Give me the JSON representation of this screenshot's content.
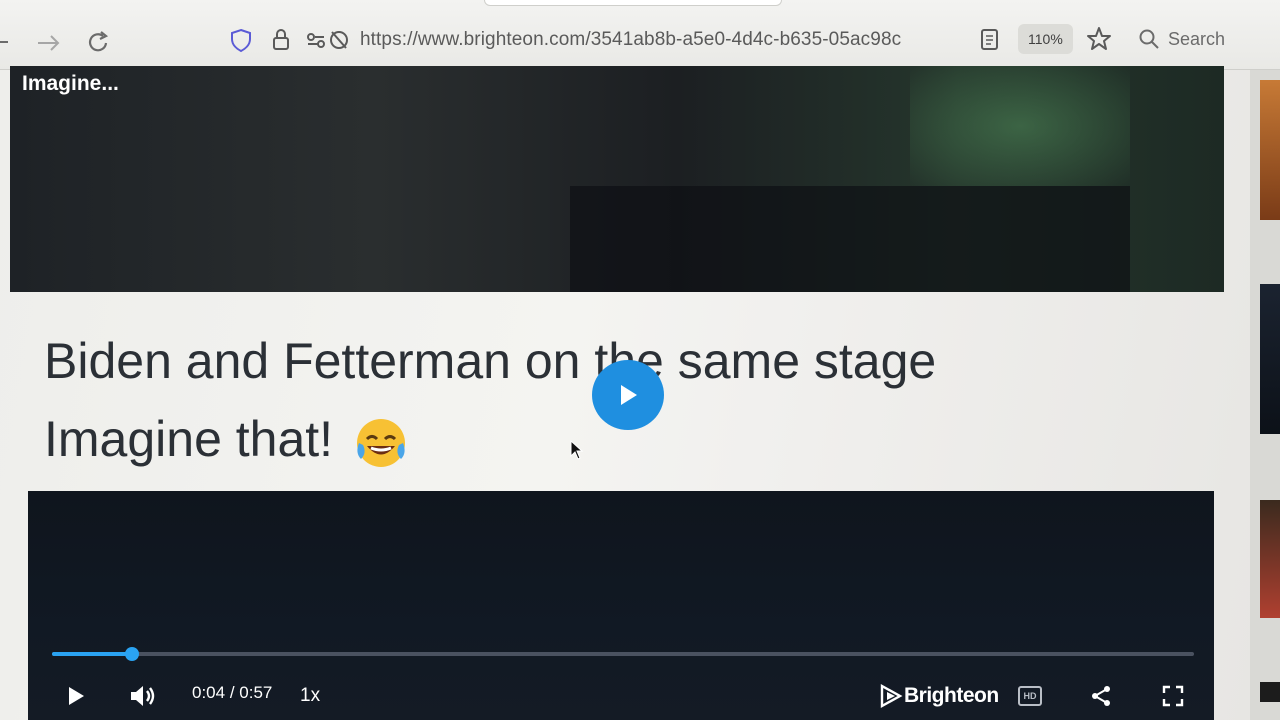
{
  "browser": {
    "url": "https://www.brighteon.com/3541ab8b-a5e0-4d4c-b635-05ac98c",
    "zoom": "110%",
    "search_label": "Search"
  },
  "post": {
    "video_title": "Imagine...",
    "text_line1": "Biden and Fetterman on the same stage",
    "text_line2": "Imagine that!",
    "emoji": "face-with-tears-of-joy"
  },
  "player": {
    "current_time": "0:04",
    "separator": "/",
    "duration": "0:57",
    "progress_fraction": 0.07,
    "speed": "1x",
    "brand": "Brighteon",
    "hd_label": "HD",
    "accent_color": "#2aa3f2"
  },
  "colors": {
    "play_overlay": "#1f8fe0"
  }
}
